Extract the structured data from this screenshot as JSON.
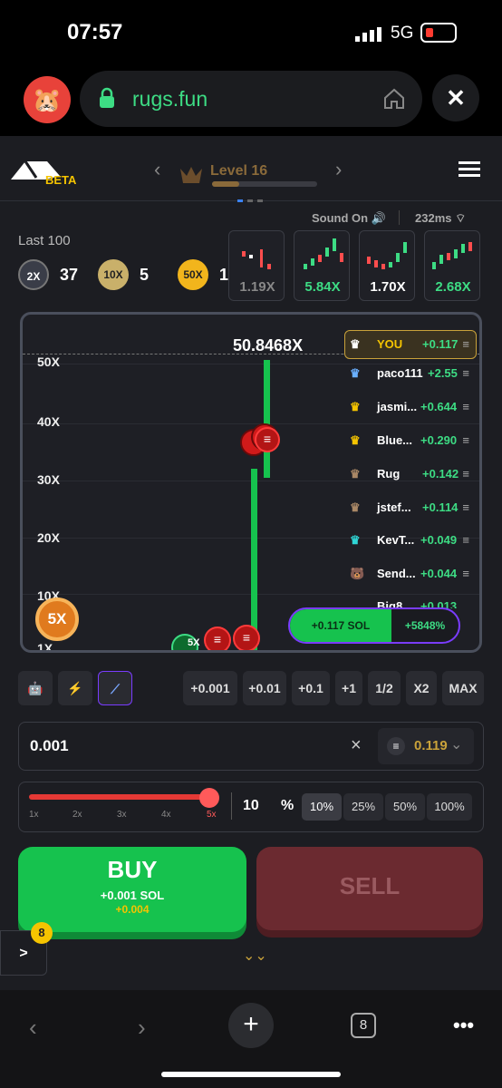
{
  "status_bar": {
    "time": "07:57",
    "network": "5G"
  },
  "browser": {
    "url": "rugs.fun",
    "tab_count": "8"
  },
  "header": {
    "badge": "BETA",
    "level": "Level 16"
  },
  "stats": {
    "sound": "Sound On",
    "ping": "232ms"
  },
  "last100": {
    "label": "Last 100",
    "coins": [
      {
        "label": "2X",
        "count": "37",
        "color": "#3a3d48"
      },
      {
        "label": "10X",
        "count": "5",
        "color": "#c9b06a"
      },
      {
        "label": "50X",
        "count": "1",
        "color": "#f2b51c"
      }
    ]
  },
  "history": [
    "1.19X",
    "5.84X",
    "1.70X",
    "2.68X"
  ],
  "chart": {
    "current": "50.8468X",
    "yticks": [
      "50X",
      "40X",
      "30X",
      "20X",
      "10X",
      "1X"
    ],
    "multiplier_badge": "5X",
    "small_badge": "5X"
  },
  "leaderboard": [
    {
      "name": "YOU",
      "pnl": "+0.117"
    },
    {
      "name": "paco111",
      "pnl": "+2.55"
    },
    {
      "name": "jasmi...",
      "pnl": "+0.644"
    },
    {
      "name": "Blue...",
      "pnl": "+0.290"
    },
    {
      "name": "Rug",
      "pnl": "+0.142"
    },
    {
      "name": "jstef...",
      "pnl": "+0.114"
    },
    {
      "name": "KevT...",
      "pnl": "+0.049"
    },
    {
      "name": "Send...",
      "pnl": "+0.044"
    },
    {
      "name": "Big8...",
      "pnl": "+0.013"
    }
  ],
  "position": {
    "sol": "+0.117 SOL",
    "pct": "+5848%"
  },
  "quick": [
    "+0.001",
    "+0.01",
    "+0.1",
    "+1",
    "1/2",
    "X2",
    "MAX"
  ],
  "amount": {
    "value": "0.001",
    "clear": "×",
    "balance": "0.119"
  },
  "slider": {
    "ticks": [
      "1x",
      "2x",
      "3x",
      "4x",
      "5x"
    ],
    "value": "10",
    "unit": "%",
    "presets": [
      "10%",
      "25%",
      "50%",
      "100%"
    ]
  },
  "buy": {
    "label": "BUY",
    "line1": "+0.001 SOL",
    "line2": "+0.004"
  },
  "sell": {
    "label": "SELL"
  },
  "side": {
    "badge": "8",
    "arrow": ">"
  }
}
